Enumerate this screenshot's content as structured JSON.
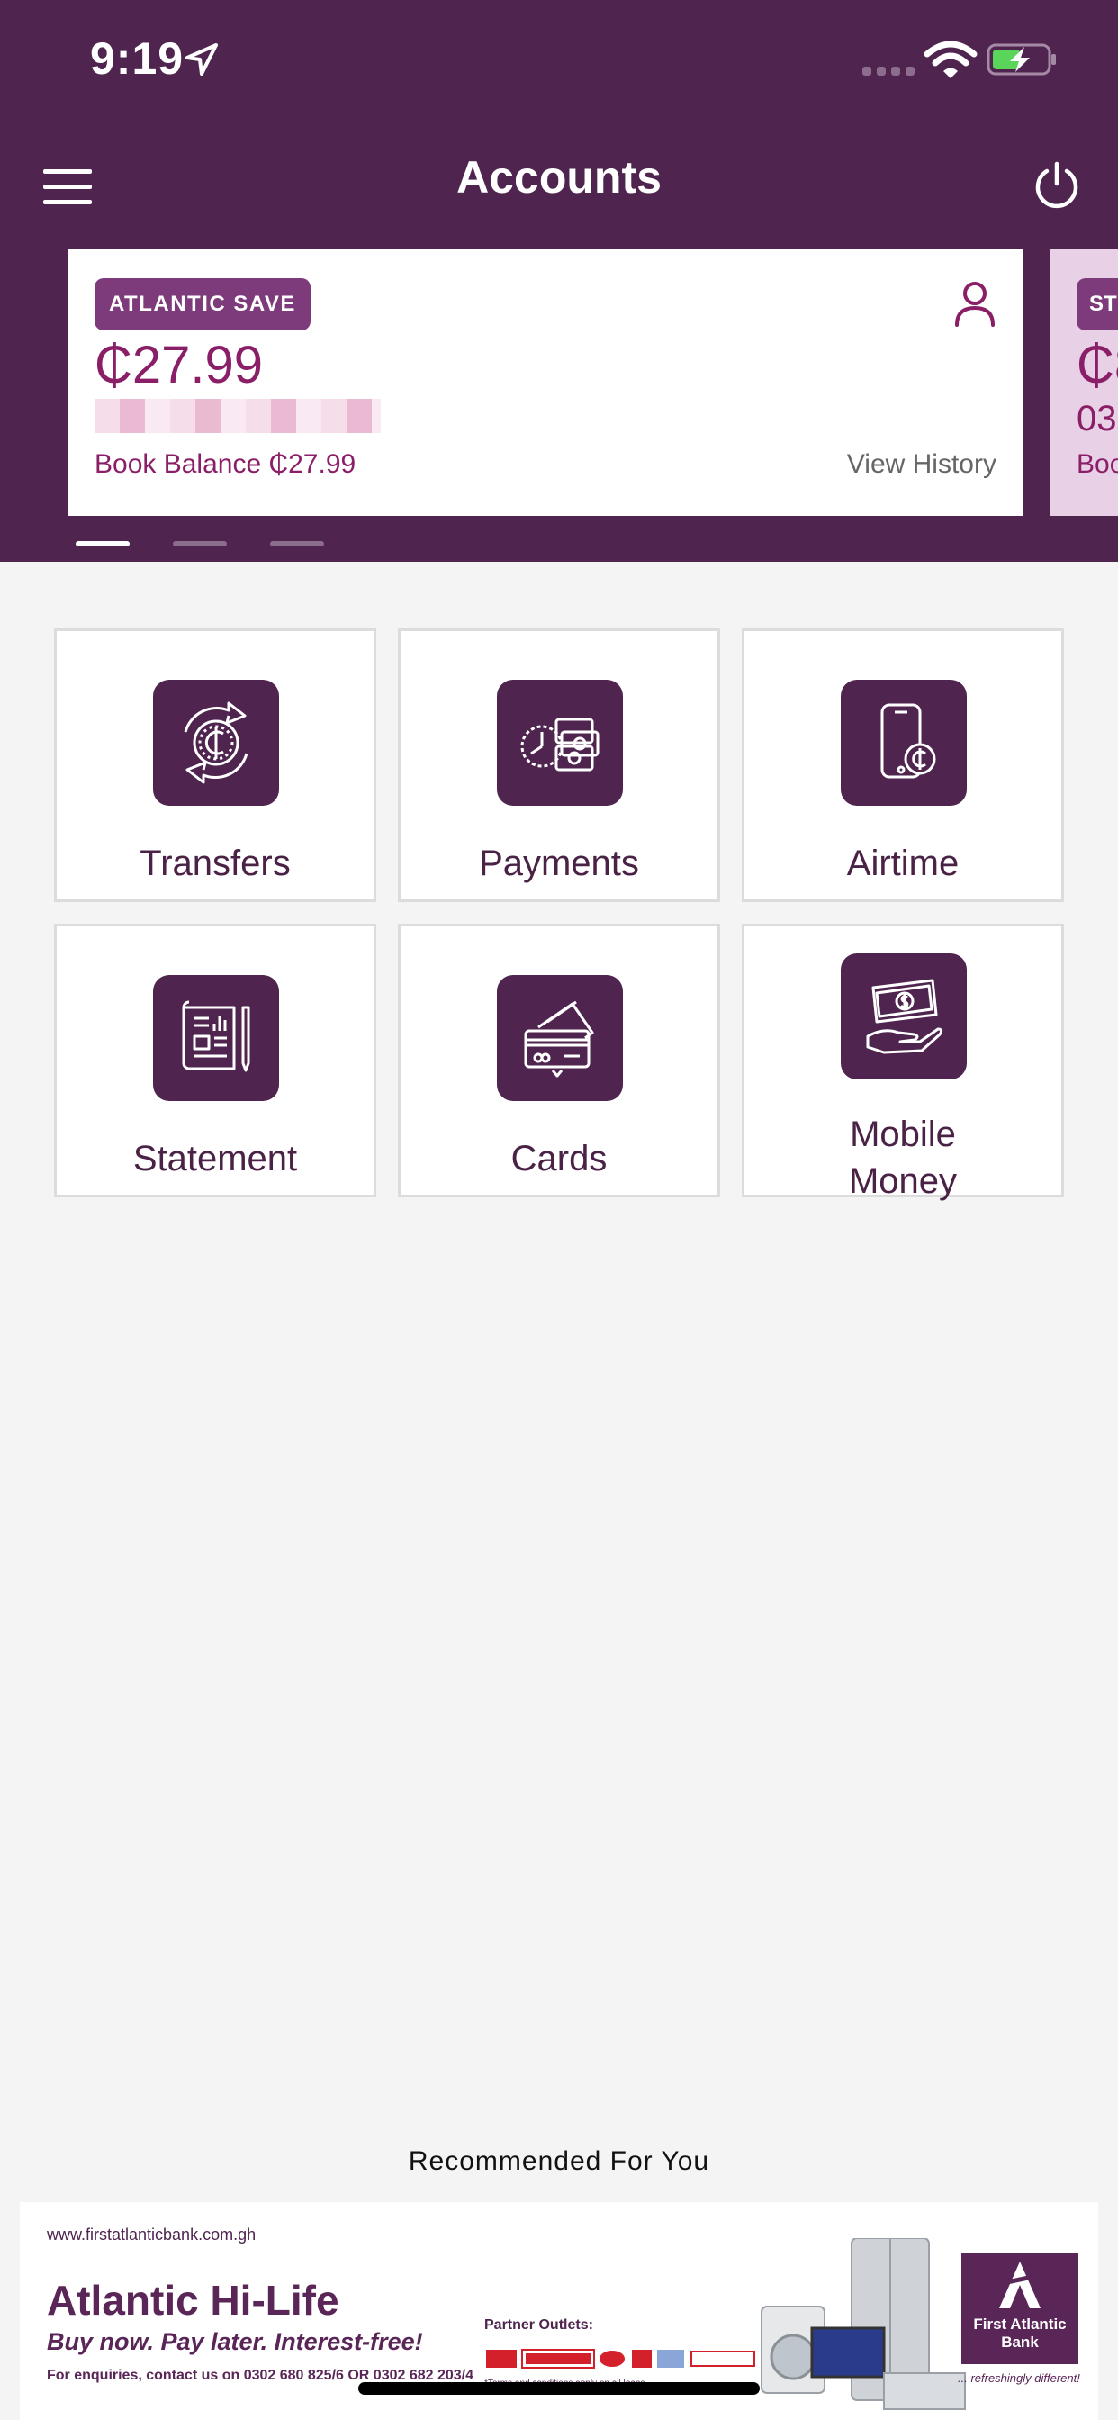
{
  "status_bar": {
    "time": "9:19"
  },
  "header": {
    "title": "Accounts"
  },
  "accounts": [
    {
      "type": "ATLANTIC SAVE",
      "balance": "₵27.99",
      "book_balance": "Book Balance ₵27.99",
      "history_label": "View History"
    }
  ],
  "next_account_peek": {
    "badge": "ST",
    "balance": "₵8",
    "number": "03",
    "book": "Boo"
  },
  "carousel": {
    "pages": 3,
    "active": 1
  },
  "tiles": [
    {
      "label": "Transfers",
      "icon": "transfer-cedi-icon"
    },
    {
      "label": "Payments",
      "icon": "payments-icon"
    },
    {
      "label": "Airtime",
      "icon": "phone-cedi-icon"
    },
    {
      "label": "Statement",
      "icon": "statement-icon"
    },
    {
      "label": "Cards",
      "icon": "cards-icon"
    },
    {
      "label": "Mobile Money",
      "icon": "mobile-money-icon"
    }
  ],
  "recommended": {
    "title": "Recommended For You",
    "banner": {
      "url": "www.firstatlanticbank.com.gh",
      "headline": "Atlantic Hi-Life",
      "subline": "Buy now. Pay later. Interest-free!",
      "contact": "For enquiries, contact us on 0302 680 825/6 OR 0302 682 203/4",
      "partner_label": "Partner Outlets:",
      "terms": "*Terms and conditions apply on all loans",
      "bank_name": "First Atlantic Bank",
      "tagline": "... refreshingly different!"
    }
  },
  "colors": {
    "brand": "#4f2550",
    "accent": "#8a1f67",
    "badge": "#7e3b7b"
  }
}
